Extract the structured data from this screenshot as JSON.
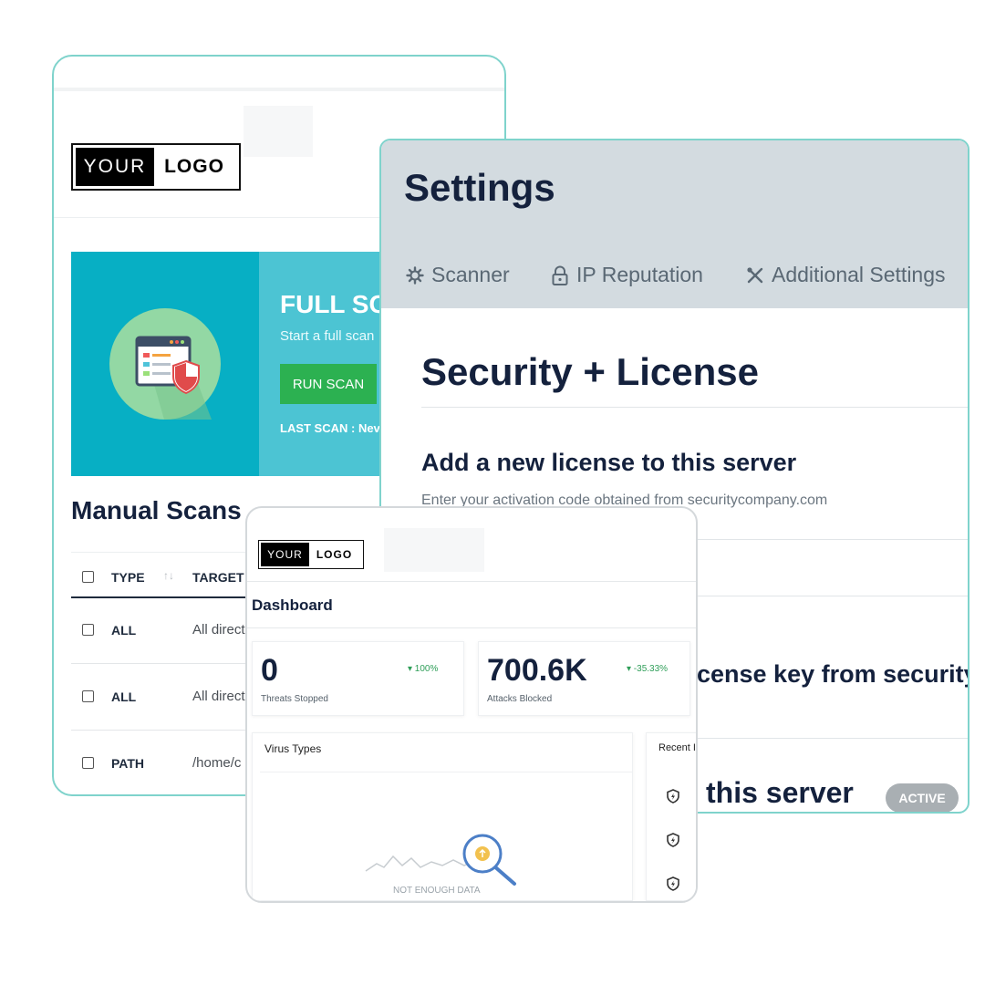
{
  "scanner_card": {
    "logo": {
      "left": "YOUR",
      "right": "LOGO"
    },
    "banner": {
      "title": "FULL SC",
      "subtitle": "Start a full scan",
      "run_button": "RUN SCAN",
      "last_scan": "LAST SCAN : Nev"
    },
    "manual_title": "Manual Scans",
    "table": {
      "headers": {
        "type": "TYPE",
        "sort": "↑↓",
        "target": "TARGET"
      },
      "rows": [
        {
          "type": "ALL",
          "target": "All direct"
        },
        {
          "type": "ALL",
          "target": "All direct"
        },
        {
          "type": "PATH",
          "target": "/home/c"
        }
      ]
    }
  },
  "settings_card": {
    "title": "Settings",
    "tabs": [
      {
        "label": "Scanner",
        "icon": "gear-icon"
      },
      {
        "label": "IP Reputation",
        "icon": "lock-icon"
      },
      {
        "label": "Additional Settings",
        "icon": "tools-icon"
      }
    ],
    "section_title": "Security + License",
    "add_title": "Add a new license to this server",
    "add_subtitle": "Enter your activation code obtained from securitycompany.com",
    "key_text": "cense key from securityc",
    "server_text": "this server",
    "status_badge": "ACTIVE"
  },
  "dashboard_card": {
    "logo": {
      "left": "YOUR",
      "right": "LOGO"
    },
    "title": "Dashboard",
    "stats": [
      {
        "value": "0",
        "label": "Threats Stopped",
        "delta": "▾ 100%"
      },
      {
        "value": "700.6K",
        "label": "Attacks Blocked",
        "delta": "▾ -35.33%"
      }
    ],
    "virus_types": {
      "title": "Virus Types",
      "empty_text": "NOT ENOUGH DATA"
    },
    "recent": {
      "title": "Recent I"
    }
  },
  "colors": {
    "teal": "#07afc4",
    "teal_light": "#4cc4d3",
    "run_green": "#2cb151",
    "navy": "#14213d",
    "settings_header": "#d3dbe0",
    "delta_green": "#2e9e58"
  }
}
